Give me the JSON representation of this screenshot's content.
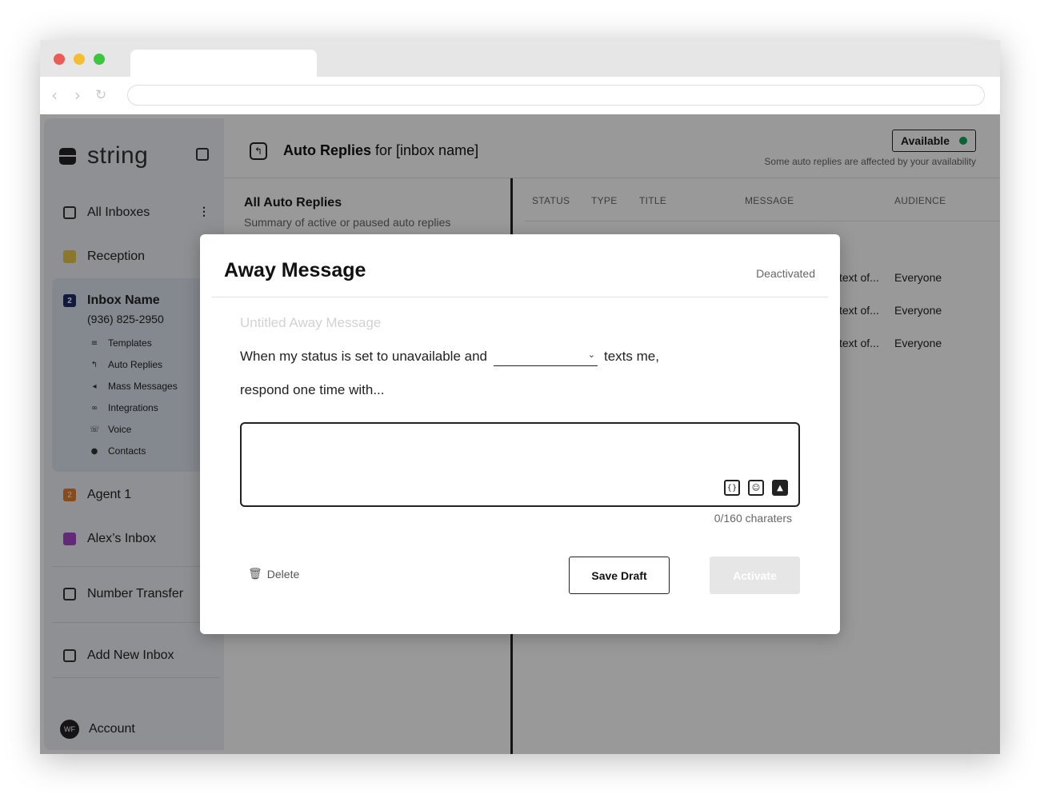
{
  "sidebar": {
    "logo_text": "string",
    "items": {
      "all_inboxes": "All Inboxes",
      "reception": "Reception",
      "inbox_name": "Inbox Name",
      "inbox_number": "(936) 825-2950",
      "inbox_badge": "2",
      "agent": "Agent 1",
      "agent_badge": "2",
      "alex": "Alex’s Inbox",
      "number_transfer": "Number Transfer",
      "add_inbox": "Add New Inbox",
      "account": "Account",
      "account_initials": "WF"
    },
    "sub_items": [
      "Templates",
      "Auto Replies",
      "Mass Messages",
      "Integrations",
      "Voice",
      "Contacts"
    ]
  },
  "header": {
    "title_bold": "Auto Replies",
    "title_rest": " for [inbox name]",
    "availability": "Available",
    "availability_note": "Some auto replies are affected by your availability"
  },
  "list": {
    "title": "All Auto Replies",
    "subtitle": "Summary of active or paused auto replies"
  },
  "table": {
    "columns": [
      "STATUS",
      "TYPE",
      "TITLE",
      "MESSAGE",
      "AUDIENCE"
    ],
    "rows": [
      {
        "message": "text of...",
        "audience": "Everyone"
      },
      {
        "message": "text of...",
        "audience": "Everyone"
      },
      {
        "message": "text of...",
        "audience": "Everyone"
      }
    ]
  },
  "modal": {
    "title": "Away Message",
    "status": "Deactivated",
    "name_placeholder": "Untitled Away Message",
    "sentence_start": "When my status is set to unavailable and",
    "sentence_end": "texts me,",
    "sentence_line2": "respond one time with...",
    "message_value": "",
    "counter": "0/160 charaters",
    "delete_label": "Delete",
    "save_label": "Save Draft",
    "activate_label": "Activate"
  },
  "icons": {
    "variables": "variables-icon",
    "emoji": "emoji-icon",
    "image": "image-icon"
  }
}
